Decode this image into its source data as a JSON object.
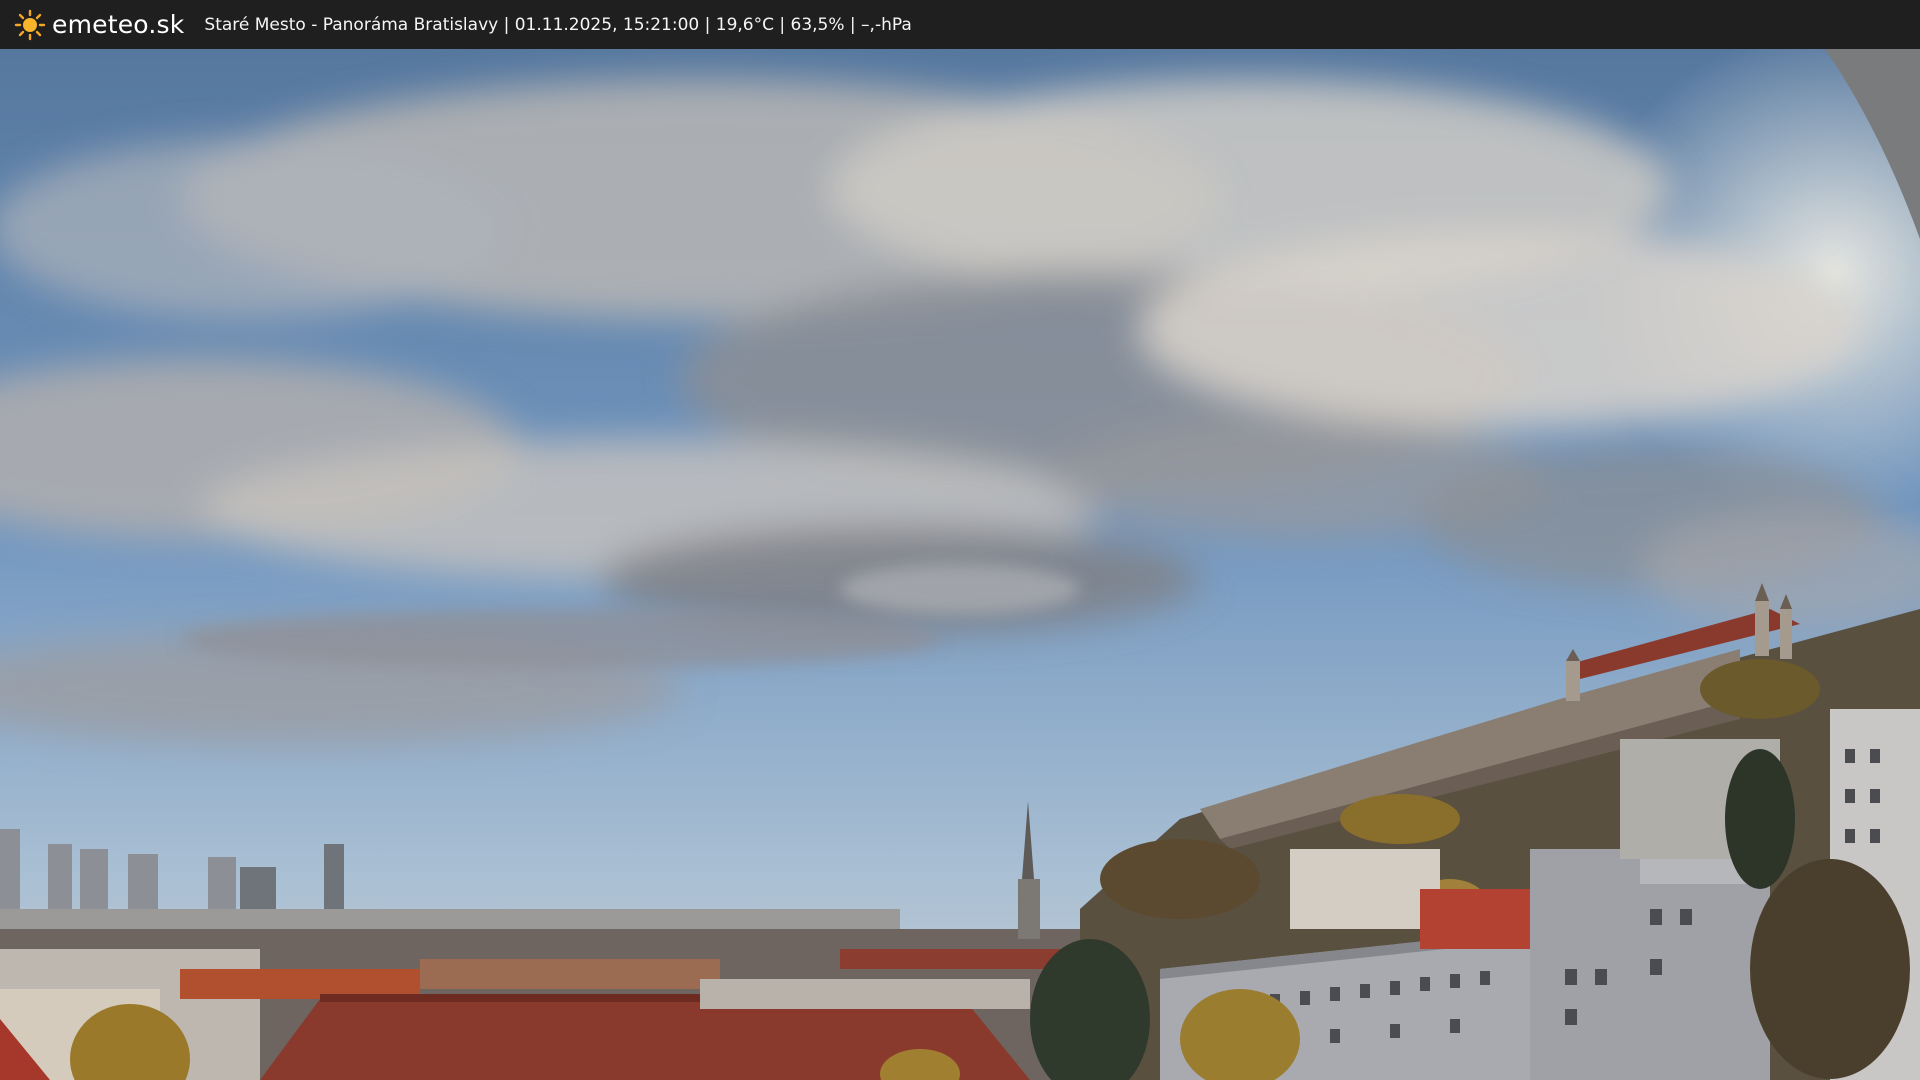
{
  "header": {
    "logo_text": "emeteo.sk",
    "logo_icon": "sun-icon",
    "caption": "Staré Mesto - Panoráma Bratislavy | 01.11.2025, 15:21:00 | 19,6°C | 63,5% | –,-hPa"
  },
  "colors": {
    "bar": "#1f1f1f",
    "sun": "#f5a623",
    "sky": "#6f94bd",
    "cloud": "#c9c5c2",
    "roof": "#8a3a2c"
  }
}
